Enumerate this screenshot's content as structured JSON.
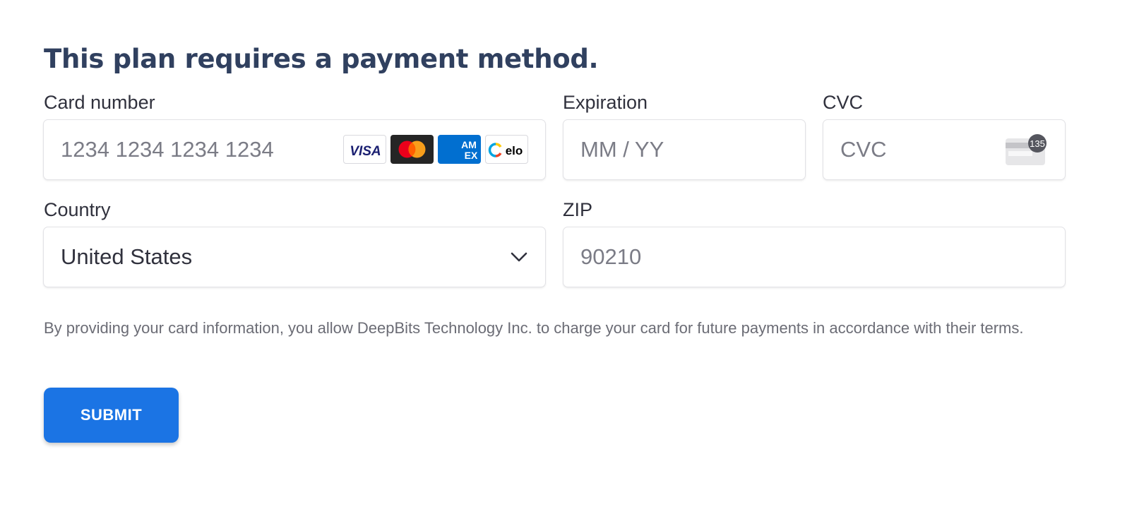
{
  "heading": "This plan requires a payment method.",
  "card_number": {
    "label": "Card number",
    "placeholder": "1234 1234 1234 1234",
    "value": "",
    "brands": [
      {
        "name": "visa-icon",
        "text": "VISA"
      },
      {
        "name": "mastercard-icon"
      },
      {
        "name": "amex-icon",
        "text": "AM EX"
      },
      {
        "name": "elo-icon",
        "text": "elo"
      }
    ]
  },
  "expiration": {
    "label": "Expiration",
    "placeholder": "MM / YY",
    "value": ""
  },
  "cvc": {
    "label": "CVC",
    "placeholder": "CVC",
    "value": "",
    "icon_text": "135"
  },
  "country": {
    "label": "Country",
    "selected": "United States"
  },
  "zip": {
    "label": "ZIP",
    "placeholder": "90210",
    "value": ""
  },
  "disclaimer": "By providing your card information, you allow DeepBits Technology Inc. to charge your card for future payments in accordance with their terms.",
  "submit_label": "SUBMIT",
  "colors": {
    "heading": "#30405f",
    "primary_button": "#1b74e4",
    "field_border": "#e2e2e6",
    "placeholder": "#7b7c86"
  }
}
